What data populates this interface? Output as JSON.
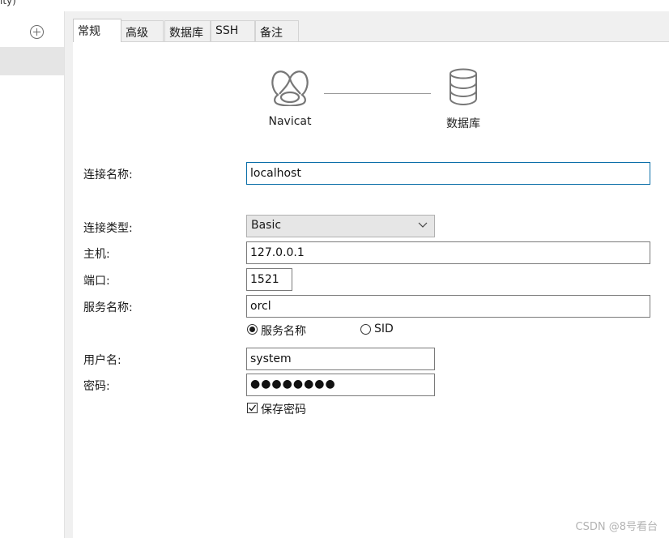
{
  "window": {
    "title_fragment": "ity)"
  },
  "tabs": [
    {
      "label": "常规",
      "active": true
    },
    {
      "label": "高级",
      "active": false
    },
    {
      "label": "数据库",
      "active": false
    },
    {
      "label": "SSH",
      "active": false
    },
    {
      "label": "备注",
      "active": false
    }
  ],
  "diagram": {
    "source_label": "Navicat",
    "target_label": "数据库"
  },
  "form": {
    "connection_name_label": "连接名称:",
    "connection_name_value": "localhost",
    "connection_type_label": "连接类型:",
    "connection_type_value": "Basic",
    "host_label": "主机:",
    "host_value": "127.0.0.1",
    "port_label": "端口:",
    "port_value": "1521",
    "service_name_label": "服务名称:",
    "service_name_value": "orcl",
    "radio_service_name_label": "服务名称",
    "radio_sid_label": "SID",
    "radio_selected": "服务名称",
    "username_label": "用户名:",
    "username_value": "system",
    "password_label": "密码:",
    "password_value": "●●●●●●●●",
    "save_password_label": "保存密码",
    "save_password_checked": true
  },
  "watermark": "CSDN @8号看台",
  "colors": {
    "focus_border": "#0a6ea8",
    "select_bg": "#e6e6e6",
    "selected_row": "#e5e5e5"
  }
}
